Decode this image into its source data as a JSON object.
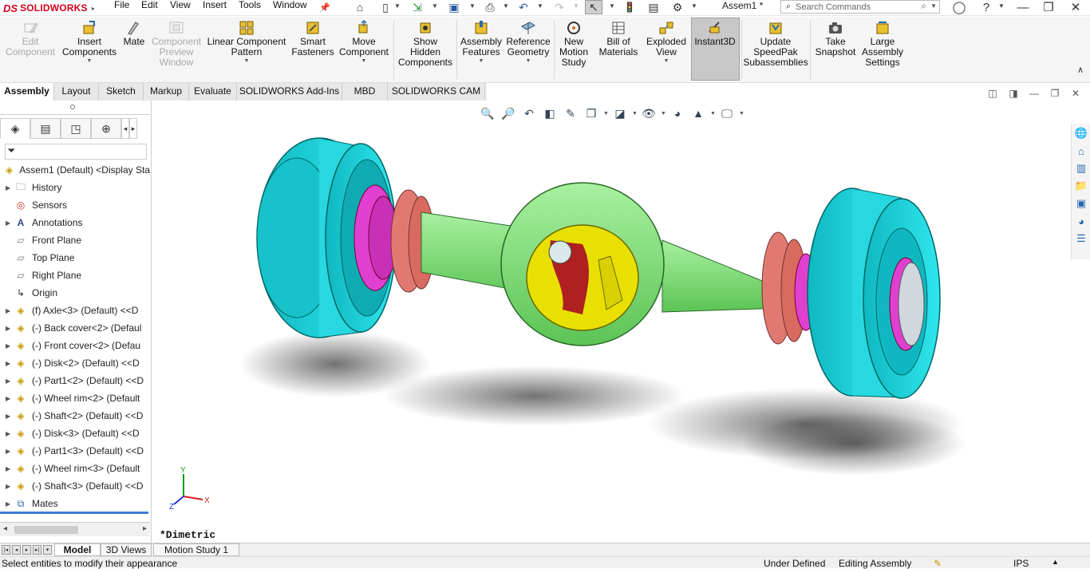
{
  "app": {
    "brand_prefix": "DS",
    "brand_name": "SOLIDWORKS",
    "document_title": "Assem1 *"
  },
  "menu": [
    "File",
    "Edit",
    "View",
    "Insert",
    "Tools",
    "Window"
  ],
  "search": {
    "placeholder": "Search Commands"
  },
  "commands": {
    "edit_component": "Edit\nComponent",
    "insert_components": "Insert\nComponents",
    "mate": "Mate",
    "component_preview": "Component\nPreview\nWindow",
    "linear_pattern": "Linear Component\nPattern",
    "smart_fasteners": "Smart\nFasteners",
    "move_component": "Move\nComponent",
    "show_hidden": "Show\nHidden\nComponents",
    "assembly_features": "Assembly\nFeatures",
    "reference_geometry": "Reference\nGeometry",
    "new_motion_study": "New\nMotion\nStudy",
    "bill_of_materials": "Bill of\nMaterials",
    "exploded_view": "Exploded\nView",
    "instant3d": "Instant3D",
    "update_speedpak": "Update\nSpeedPak\nSubassemblies",
    "take_snapshot": "Take\nSnapshot",
    "large_assembly": "Large\nAssembly\nSettings"
  },
  "tabs": [
    "Assembly",
    "Layout",
    "Sketch",
    "Markup",
    "Evaluate",
    "SOLIDWORKS Add-Ins",
    "MBD",
    "SOLIDWORKS CAM"
  ],
  "tree": {
    "root": "Assem1 (Default) <Display Sta",
    "items": [
      "History",
      "Sensors",
      "Annotations",
      "Front Plane",
      "Top Plane",
      "Right Plane",
      "Origin",
      "(f) Axle<3> (Default) <<D",
      "(-) Back cover<2> (Defaul",
      "(-) Front cover<2> (Defau",
      "(-) Disk<2> (Default) <<D",
      "(-) Part1<2> (Default) <<D",
      "(-) Wheel rim<2> (Default",
      "(-) Shaft<2> (Default) <<D",
      "(-) Disk<3> (Default) <<D",
      "(-) Part1<3> (Default) <<D",
      "(-) Wheel rim<3> (Default",
      "(-) Shaft<3> (Default) <<D",
      "Mates"
    ]
  },
  "view_name": "*Dimetric",
  "triad": {
    "x": "X",
    "y": "Y",
    "z": "Z"
  },
  "bottom_tabs": [
    "Model",
    "3D Views",
    "Motion Study 1"
  ],
  "status": {
    "message": "Select entities to modify their appearance",
    "definition": "Under Defined",
    "mode": "Editing Assembly",
    "units": "IPS"
  },
  "colors": {
    "wheel": "#00c8d0",
    "housing": "#7fe07a",
    "cover": "#e8e000",
    "disk": "#e07a70",
    "hub": "#e040d0",
    "accent_blue": "#3d7bd6",
    "brand_red": "#d4001c"
  }
}
